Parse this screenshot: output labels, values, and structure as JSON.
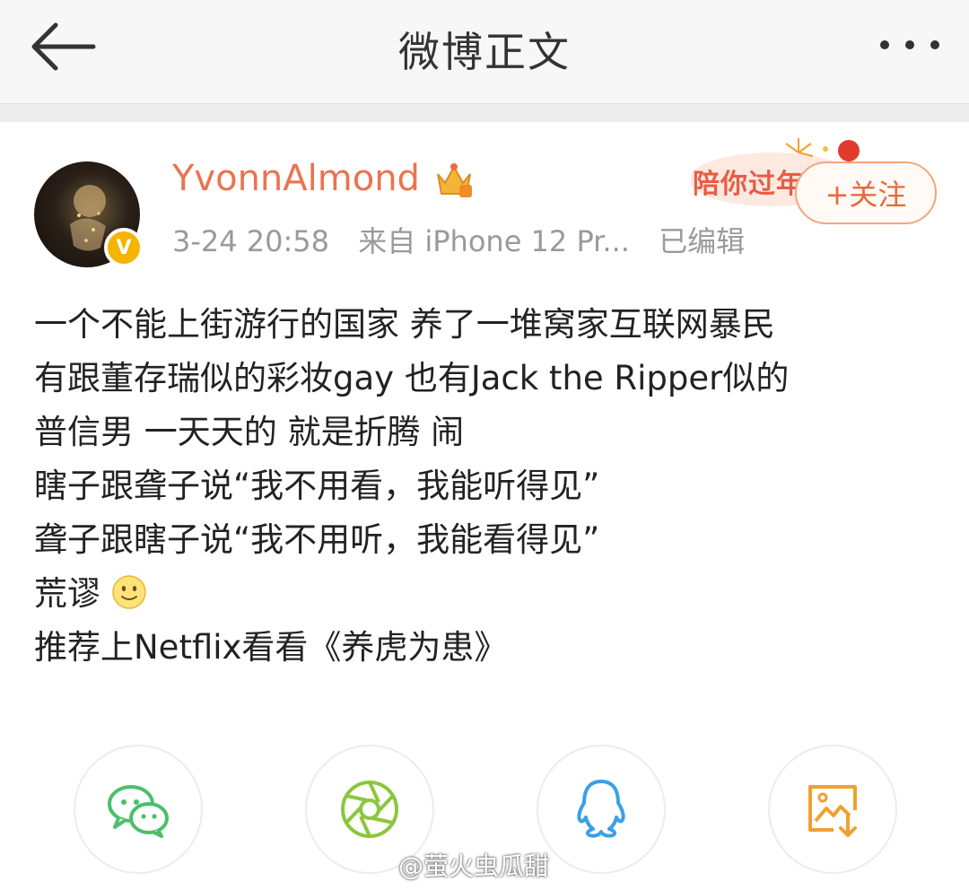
{
  "header": {
    "title": "微博正文"
  },
  "post": {
    "username": "YvonnAlmond",
    "timestamp": "3-24 20:58",
    "source": "来自 iPhone 12 Pr...",
    "edited": "已编辑",
    "follow_label": "+关注",
    "promo_text": "陪你过年",
    "lines": [
      "一个不能上街游行的国家 养了一堆窝家互联网暴民",
      "有跟董存瑞似的彩妆gay 也有Jack the Ripper似的",
      "普信男 一天天的 就是折腾 闹",
      "瞎子跟聋子说“我不用看，我能听得见”",
      "聋子跟瞎子说“我不用听，我能看得见”",
      "荒谬",
      "推荐上Netflix看看《养虎为患》"
    ]
  },
  "share": {
    "icons": [
      "wechat-icon",
      "moments-icon",
      "qq-icon",
      "save-image-icon"
    ]
  },
  "watermark": "@萤火虫瓜甜",
  "colors": {
    "username": "#eb7350",
    "follow": "#e8693c",
    "wechat": "#4cbf6a",
    "moments": "#8cc63f",
    "qq": "#3aa0e8",
    "save": "#f0a030"
  }
}
